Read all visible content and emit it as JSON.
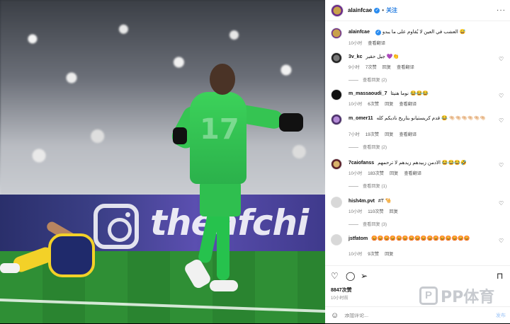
{
  "header": {
    "username": "alainfcae",
    "verified_glyph": "✓",
    "separator": "•",
    "follow_label": "关注",
    "more_glyph": "···"
  },
  "caption": {
    "username": "alainfcae",
    "text": "العشب في العين لا يُقاوم على ما يبدو 😅",
    "time": "10小时",
    "translate": "查看翻译"
  },
  "comments": [
    {
      "user": "3v_kc",
      "text": "جيل حقير 💜👏",
      "time": "9小时",
      "likes": "7次赞",
      "reply": "回复",
      "translate": "查看翻译",
      "replies": "查看回复 (2)"
    },
    {
      "user": "m_massaoudi_7",
      "text": "نوما هنيئا 😂😂😂",
      "time": "10小时",
      "likes": "6次赞",
      "reply": "回复",
      "translate": "查看翻译",
      "replies": ""
    },
    {
      "user": "m_omer11",
      "text": "قدم كريستيانو بتاريخ ناديكم كله 😂 🤏🏻🤏🏻🤏🏻🤏🏻🤏🏻🤏🏻",
      "time": "7小时",
      "likes": "19次赞",
      "reply": "回复",
      "translate": "查看翻译",
      "replies": "查看回复 (2)"
    },
    {
      "user": "7caiofanss",
      "text": "الادمن زبيدهم زيدهم لا ترحمهم 😂😂😂🤣",
      "time": "10小时",
      "likes": "183次赞",
      "reply": "回复",
      "translate": "查看翻译",
      "replies": "查看回复 (1)"
    },
    {
      "user": "hish4m.pvt",
      "text": "#T 🐪",
      "time": "10小时",
      "likes": "110次赞",
      "reply": "回复",
      "translate": "",
      "replies": "查看回复 (3)"
    },
    {
      "user": "jstfatom",
      "text": "😡😡😡😡😡😡😡😡😡😡😡😡😡😡😡😡",
      "time": "10小时",
      "likes": "9次赞",
      "reply": "回复",
      "translate": "",
      "replies": ""
    }
  ],
  "actions": {
    "likes": "8847次赞",
    "time": "10小时前",
    "comment_placeholder": "添加评论...",
    "post_label": "发布"
  },
  "photo": {
    "board_text": "theafchi",
    "jersey_number": "17"
  },
  "watermark": {
    "mark": "P",
    "text": "PP体育"
  },
  "colors": {
    "accent": "#1f7ae0",
    "verified": "#2a8cf0",
    "pitch": "#2f8f35",
    "keeper_kit": "#35c452"
  },
  "icons": [
    "heart-icon",
    "comment-icon",
    "share-icon",
    "bookmark-icon",
    "emoji-icon",
    "more-icon"
  ]
}
